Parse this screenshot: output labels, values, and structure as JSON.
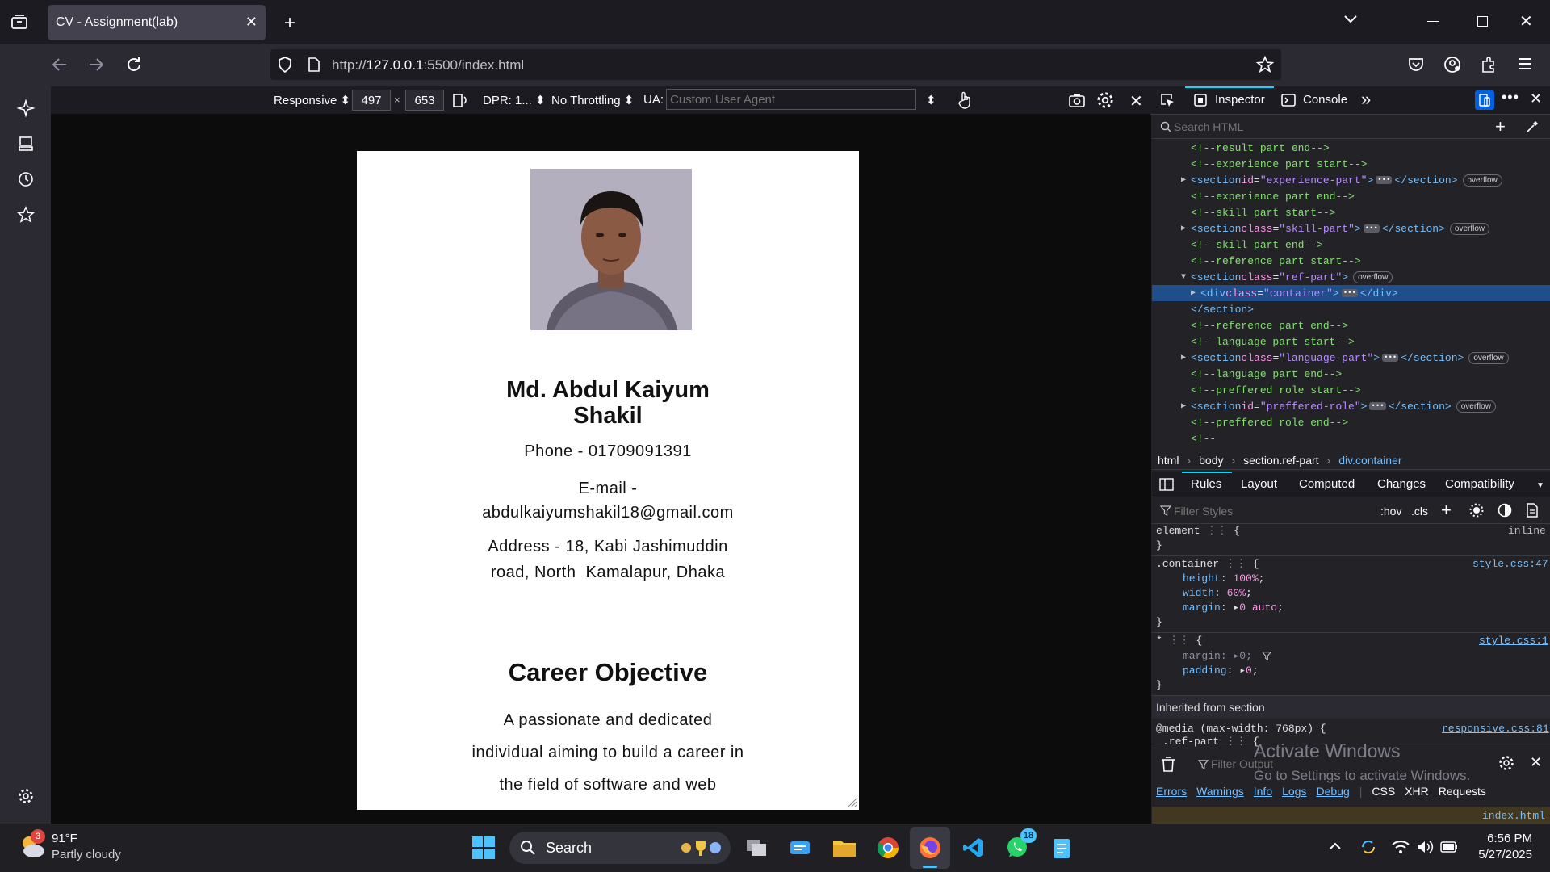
{
  "browser": {
    "tab_title": "CV - Assignment(lab)",
    "url_prefix": "http://",
    "url_host": "127.0.0.1",
    "url_rest": ":5500/index.html"
  },
  "rdm": {
    "device": "Responsive",
    "width": "497",
    "times": "×",
    "height": "653",
    "dpr": "DPR: 1...",
    "throttle": "No Throttling",
    "ua_label": "UA:",
    "ua_placeholder": "Custom User Agent"
  },
  "cv": {
    "name_line1": "Md. Abdul Kaiyum",
    "name_line2": "Shakil",
    "phone": "Phone - 01709091391",
    "email_label": "E-mail -",
    "email": "abdulkaiyumshakil18@gmail.com",
    "address_line1": "Address - 18, Kabi Jashimuddin",
    "address_line2": "road, North  Kamalapur, Dhaka",
    "career_heading": "Career Objective",
    "objective_lines": [
      "A passionate and dedicated",
      "individual aiming to build a career in",
      "the field of software and web"
    ]
  },
  "devtools": {
    "tabs": [
      "Inspector",
      "Console"
    ],
    "search_placeholder": "Search HTML",
    "tree": [
      {
        "type": "comment",
        "text": "<!--result part end-->"
      },
      {
        "type": "comment",
        "text": "<!--experience part start-->"
      },
      {
        "type": "element",
        "open": "<section",
        "attr": "id",
        "val": "\"experience-part\"",
        "close": "</section>",
        "badge": "overflow"
      },
      {
        "type": "comment",
        "text": "<!--experience part end-->"
      },
      {
        "type": "comment",
        "text": "<!--skill part start-->"
      },
      {
        "type": "element",
        "open": "<section",
        "attr": "class",
        "val": "\"skill-part\"",
        "close": "</section>",
        "badge": "overflow"
      },
      {
        "type": "comment",
        "text": "<!--skill part end-->"
      },
      {
        "type": "comment",
        "text": "<!--reference part start-->"
      },
      {
        "type": "open",
        "open": "<section",
        "attr": "class",
        "val": "\"ref-part\"",
        "badge": "overflow"
      },
      {
        "type": "selected",
        "open": "<div",
        "attr": "class",
        "val": "\"container\"",
        "close": "</div>"
      },
      {
        "type": "closetag",
        "text": "</section>"
      },
      {
        "type": "comment",
        "text": "<!--reference part end-->"
      },
      {
        "type": "comment",
        "text": "<!--language part start-->"
      },
      {
        "type": "element",
        "open": "<section",
        "attr": "class",
        "val": "\"language-part\"",
        "close": "</section>",
        "badge": "overflow"
      },
      {
        "type": "comment",
        "text": "<!--language part end-->"
      },
      {
        "type": "comment",
        "text": "<!--preffered role start-->"
      },
      {
        "type": "element",
        "open": "<section",
        "attr": "id",
        "val": "\"preffered-role\"",
        "close": "</section>",
        "badge": "overflow"
      },
      {
        "type": "comment",
        "text": "<!--preffered role end-->"
      },
      {
        "type": "comment",
        "text": "<!--"
      }
    ],
    "breadcrumbs": [
      "html",
      "body",
      "section.ref-part",
      "div.container"
    ],
    "rule_tabs": [
      "Rules",
      "Layout",
      "Computed",
      "Changes",
      "Compatibility"
    ],
    "filter_placeholder": "Filter Styles",
    "hov": ":hov",
    "cls": ".cls",
    "rules": {
      "element_sel": "element",
      "inline": "inline",
      "container_sel": ".container",
      "container_src": "style.css:47",
      "p1": "height",
      "v1": "100%",
      "p2": "width",
      "v2": "60%",
      "p3": "margin",
      "v3": "0 auto",
      "star_sel": "*",
      "star_src": "style.css:1",
      "p4": "margin",
      "v4": "0",
      "p5": "padding",
      "v5": "0",
      "inherited": "Inherited from section",
      "media": "@media (max-width: 768px) {",
      "media_src": "responsive.css:81",
      "refpart": ".ref-part"
    },
    "console": {
      "filter_placeholder": "Filter Output",
      "levels": [
        "Errors",
        "Warnings",
        "Info",
        "Logs",
        "Debug"
      ],
      "types": [
        "CSS",
        "XHR",
        "Requests"
      ],
      "file": "index.html"
    },
    "watermark_title": "Activate Windows",
    "watermark_sub": "Go to Settings to activate Windows."
  },
  "taskbar": {
    "weather_temp": "91°F",
    "weather_desc": "Partly cloudy",
    "weather_badge": "3",
    "search": "Search",
    "whatsapp_badge": "18",
    "time": "6:56 PM",
    "date": "5/27/2025"
  }
}
